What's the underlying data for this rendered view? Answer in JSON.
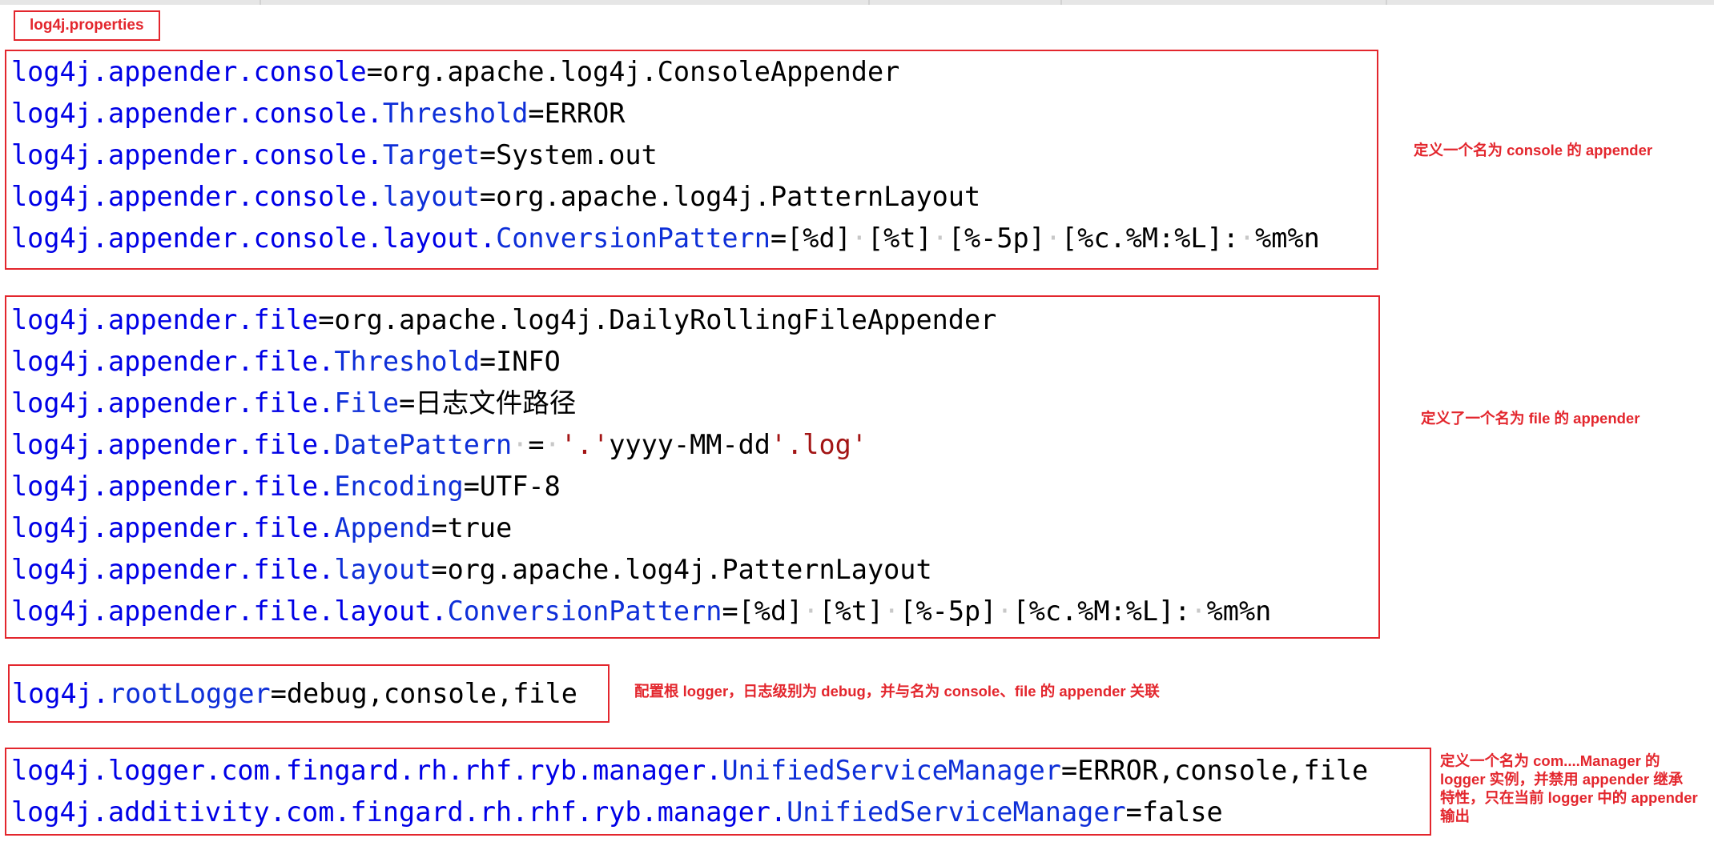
{
  "file_label": "log4j.properties",
  "blocks": {
    "console": {
      "lines": [
        {
          "key": "log4j.appender.console",
          "sub": "",
          "eq": "=",
          "value": "org.apache.log4j.ConsoleAppender"
        },
        {
          "key": "log4j.appender.console.",
          "sub": "Threshold",
          "eq": "=",
          "value": "ERROR"
        },
        {
          "key": "log4j.appender.console.",
          "sub": "Target",
          "eq": "=",
          "value": "System.out"
        },
        {
          "key": "log4j.appender.console.",
          "sub": "layout",
          "eq": "=",
          "value": "org.apache.log4j.PatternLayout"
        },
        {
          "key": "log4j.appender.console.layout.",
          "sub": "ConversionPattern",
          "eq": "=",
          "value": "[%d]·[%t]·[%-5p]·[%c.%M:%L]:·%m%n"
        }
      ],
      "note": "定义一个名为 console 的 appender"
    },
    "file": {
      "lines": [
        {
          "key": "log4j.appender.file",
          "sub": "",
          "eq": "=",
          "value": "org.apache.log4j.DailyRollingFileAppender"
        },
        {
          "key": "log4j.appender.file.",
          "sub": "Threshold",
          "eq": "=",
          "value": "INFO"
        },
        {
          "key": "log4j.appender.file.",
          "sub": "File",
          "eq": "=",
          "value": "日志文件路径"
        },
        {
          "key": "log4j.appender.file.",
          "sub": "DatePattern",
          "eq": "·=·",
          "value": "'.'yyyy-MM-dd'.log'"
        },
        {
          "key": "log4j.appender.file.",
          "sub": "Encoding",
          "eq": "=",
          "value": "UTF-8"
        },
        {
          "key": "log4j.appender.file.",
          "sub": "Append",
          "eq": "=",
          "value": "true"
        },
        {
          "key": "log4j.appender.file.",
          "sub": "layout",
          "eq": "=",
          "value": "org.apache.log4j.PatternLayout"
        },
        {
          "key": "log4j.appender.file.layout.",
          "sub": "ConversionPattern",
          "eq": "=",
          "value": "[%d]·[%t]·[%-5p]·[%c.%M:%L]:·%m%n"
        }
      ],
      "note": "定义了一个名为 file 的 appender"
    },
    "root": {
      "lines": [
        {
          "key": "log4j.",
          "sub": "rootLogger",
          "eq": "=",
          "value": "debug,console,file"
        }
      ],
      "note": "配置根 logger，日志级别为 debug，并与名为 console、file 的 appender 关联"
    },
    "logger": {
      "lines": [
        {
          "key": "log4j.logger.com.fingard.rh.rhf.ryb.manager.",
          "sub": "UnifiedServiceManager",
          "eq": "=",
          "value": "ERROR,console,file"
        },
        {
          "key": "log4j.additivity.com.fingard.rh.rhf.ryb.manager.",
          "sub": "UnifiedServiceManager",
          "eq": "=",
          "value": "false"
        }
      ],
      "note_lines": [
        "定义一个名为 com....Manager 的",
        "logger 实例，并禁用 appender 继承",
        "特性，只在当前 logger 中的 appender",
        "输出"
      ]
    }
  }
}
